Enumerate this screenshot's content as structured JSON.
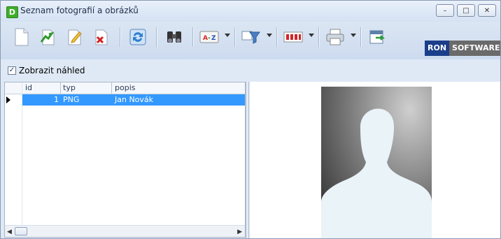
{
  "window": {
    "title": "Seznam fotografií a obrázků",
    "app_icon_letter": "D",
    "minimize_glyph": "–",
    "maximize_glyph": "□",
    "close_glyph": "✕"
  },
  "toolbar": {
    "buttons": [
      {
        "icon": "new-document-icon"
      },
      {
        "icon": "open-document-icon"
      },
      {
        "icon": "edit-document-icon"
      },
      {
        "icon": "delete-document-icon"
      },
      {
        "icon": "refresh-icon"
      },
      {
        "icon": "binoculars-icon"
      },
      {
        "icon": "sort-az-icon",
        "label": "A-Z"
      },
      {
        "icon": "filter-icon"
      },
      {
        "icon": "columns-icon"
      },
      {
        "icon": "print-icon"
      },
      {
        "icon": "export-icon"
      }
    ],
    "logo": {
      "part1": "RON",
      "part2": "SOFTWARE"
    }
  },
  "preview_toggle": {
    "label": "Zobrazit náhled",
    "checked": true,
    "check_glyph": "✓"
  },
  "grid": {
    "columns": [
      "id",
      "typ",
      "popis"
    ],
    "rows": [
      {
        "id": "1",
        "typ": "PNG",
        "popis": "Jan Novák",
        "selected": true
      }
    ],
    "scroll_left": "◀",
    "scroll_right": "▶"
  },
  "colors": {
    "selection": "#3399ff",
    "logo_blue": "#1a3e8a"
  }
}
